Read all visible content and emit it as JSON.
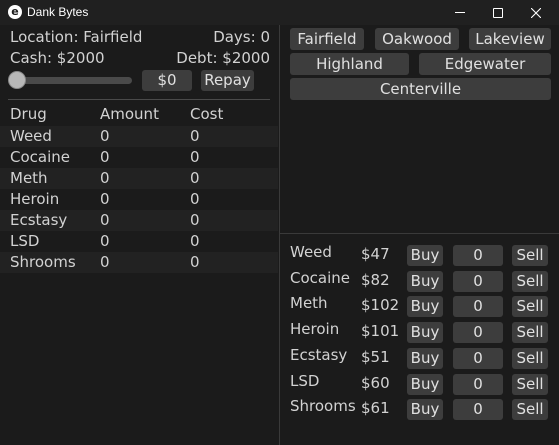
{
  "window": {
    "title": "Dank Bytes",
    "icon_letter": "e"
  },
  "status": {
    "location": "Location: Fairfield",
    "days": "Days: 0",
    "cash": "Cash: $2000",
    "debt": "Debt: $2000",
    "payment_value": "$0",
    "repay_label": "Repay"
  },
  "inventory": {
    "headers": [
      "Drug",
      "Amount",
      "Cost"
    ],
    "rows": [
      {
        "drug": "Weed",
        "amount": "0",
        "cost": "0"
      },
      {
        "drug": "Cocaine",
        "amount": "0",
        "cost": "0"
      },
      {
        "drug": "Meth",
        "amount": "0",
        "cost": "0"
      },
      {
        "drug": "Heroin",
        "amount": "0",
        "cost": "0"
      },
      {
        "drug": "Ecstasy",
        "amount": "0",
        "cost": "0"
      },
      {
        "drug": "LSD",
        "amount": "0",
        "cost": "0"
      },
      {
        "drug": "Shrooms",
        "amount": "0",
        "cost": "0"
      }
    ]
  },
  "locations": [
    "Fairfield",
    "Oakwood",
    "Lakeview",
    "Highland",
    "Edgewater",
    "Centerville"
  ],
  "market": {
    "buy_label": "Buy",
    "sell_label": "Sell",
    "rows": [
      {
        "drug": "Weed",
        "price": "$47",
        "qty": "0"
      },
      {
        "drug": "Cocaine",
        "price": "$82",
        "qty": "0"
      },
      {
        "drug": "Meth",
        "price": "$102",
        "qty": "0"
      },
      {
        "drug": "Heroin",
        "price": "$101",
        "qty": "0"
      },
      {
        "drug": "Ecstasy",
        "price": "$51",
        "qty": "0"
      },
      {
        "drug": "LSD",
        "price": "$60",
        "qty": "0"
      },
      {
        "drug": "Shrooms",
        "price": "$61",
        "qty": "0"
      }
    ]
  },
  "slider": {
    "value": 0
  }
}
